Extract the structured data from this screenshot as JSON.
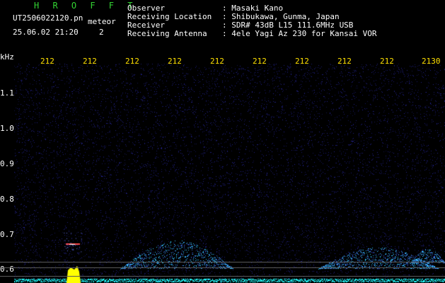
{
  "header": {
    "station_code": "H R O F F T",
    "filename": "UT2506022120.pn",
    "meteor_tag": "meteor",
    "datetime": "25.06.02 21:20",
    "count": "2"
  },
  "info": {
    "labels": [
      "Observer",
      "Receiving Location",
      "Receiver",
      "Receiving Antenna"
    ],
    "values": [
      ": Masaki Kano",
      ": Shibukawa, Gunma, Japan",
      ": SDR# 43dB L15 111.6MHz USB",
      ": 4ele Yagi Az 230 for Kansai VOR"
    ]
  },
  "axis": {
    "unit": "kHz",
    "y_ticks": [
      "1.1",
      "1.0",
      "0.9",
      "0.8",
      "0.7",
      "0.6"
    ],
    "x_ticks": [
      "212",
      "212",
      "212",
      "212",
      "212",
      "212",
      "212",
      "212",
      "212",
      "2130"
    ]
  },
  "colors": {
    "background": "#000000",
    "noise": "#1a1a66",
    "signal": "#33c7ff",
    "meteor": "#ff4a4a",
    "burst": "#ffff00",
    "baseline": "#22ffff"
  }
}
